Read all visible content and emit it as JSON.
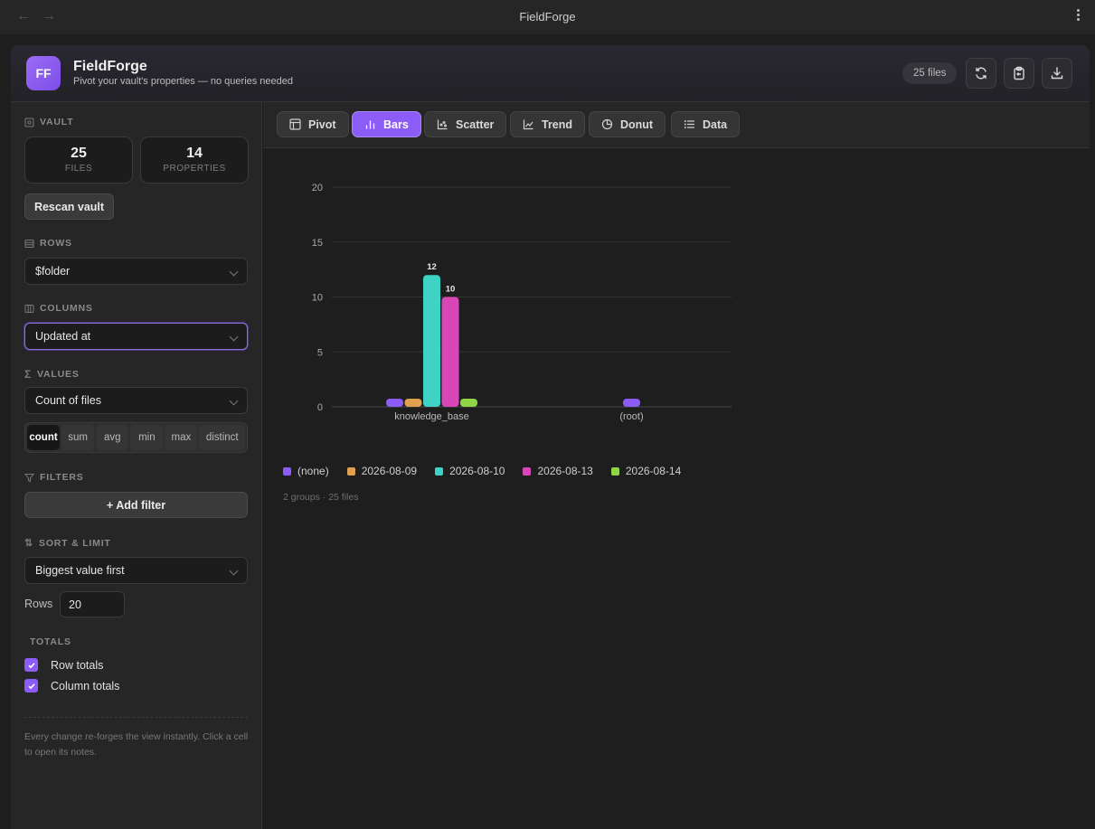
{
  "window": {
    "title": "FieldForge"
  },
  "header": {
    "logo_text": "FF",
    "app_name": "FieldForge",
    "subtitle": "Pivot your vault's properties — no queries needed",
    "file_count": "25 files"
  },
  "sidebar": {
    "vault_label": "VAULT",
    "files_count": "25",
    "files_label": "FILES",
    "properties_count": "14",
    "properties_label": "PROPERTIES",
    "rescan_label": "Rescan vault",
    "rows_label": "ROWS",
    "rows_value": "$folder",
    "columns_label": "COLUMNS",
    "columns_value": "Updated at",
    "values_label": "VALUES",
    "values_value": "Count of files",
    "aggregations": [
      "count",
      "sum",
      "avg",
      "min",
      "max",
      "distinct"
    ],
    "aggregation_selected": "count",
    "filters_label": "FILTERS",
    "add_filter_label": "+ Add filter",
    "sort_label": "SORT & LIMIT",
    "sort_value": "Biggest value first",
    "rows_limit_label": "Rows",
    "rows_limit_value": "20",
    "totals_label": "TOTALS",
    "row_totals_label": "Row totals",
    "row_totals_checked": true,
    "column_totals_label": "Column totals",
    "column_totals_checked": true,
    "hint": "Every change re-forges the view instantly. Click a cell to open its notes."
  },
  "tabs": [
    {
      "label": "Pivot",
      "icon": "table-icon"
    },
    {
      "label": "Bars",
      "icon": "bar-chart-icon",
      "active": true
    },
    {
      "label": "Scatter",
      "icon": "scatter-icon"
    },
    {
      "label": "Trend",
      "icon": "trend-icon"
    },
    {
      "label": "Donut",
      "icon": "donut-icon"
    },
    {
      "label": "Data",
      "icon": "list-icon"
    }
  ],
  "chart_data": {
    "type": "bar",
    "categories": [
      "knowledge_base",
      "(root)"
    ],
    "series": [
      {
        "name": "(none)",
        "color": "#8b5cf6",
        "values": [
          0,
          0
        ]
      },
      {
        "name": "2026-08-09",
        "color": "#e0a050",
        "values": [
          0,
          null
        ]
      },
      {
        "name": "2026-08-10",
        "color": "#3fd3c6",
        "values": [
          12,
          null
        ]
      },
      {
        "name": "2026-08-13",
        "color": "#d946b8",
        "values": [
          10,
          null
        ]
      },
      {
        "name": "2026-08-14",
        "color": "#8fd545",
        "values": [
          0,
          null
        ]
      }
    ],
    "data_labels": [
      {
        "category": "knowledge_base",
        "series": "2026-08-10",
        "text": "12"
      },
      {
        "category": "knowledge_base",
        "series": "2026-08-13",
        "text": "10"
      }
    ],
    "yticks": [
      0,
      5,
      10,
      15,
      20
    ],
    "ylim": [
      0,
      20
    ],
    "grid": true,
    "legend": "bottom-left"
  },
  "chart_footer": "2 groups · 25 files"
}
